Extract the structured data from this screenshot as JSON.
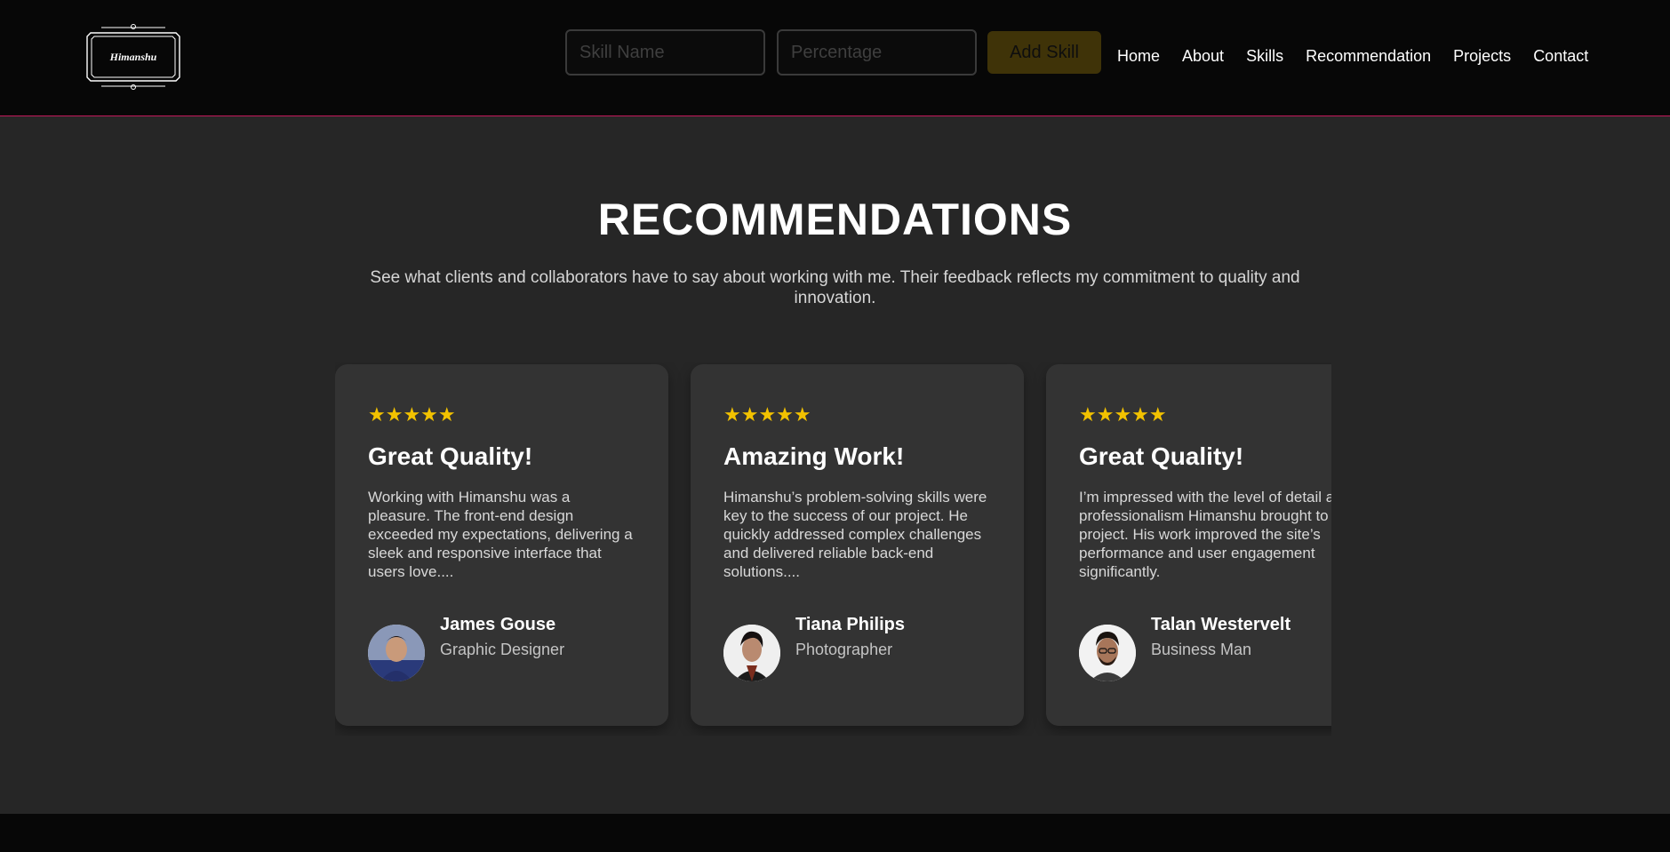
{
  "logo": {
    "text": "Himanshu"
  },
  "skill_form": {
    "name_placeholder": "Skill Name",
    "percentage_placeholder": "Percentage",
    "add_label": "Add Skill"
  },
  "nav": [
    {
      "label": "Home"
    },
    {
      "label": "About"
    },
    {
      "label": "Skills"
    },
    {
      "label": "Recommendation"
    },
    {
      "label": "Projects"
    },
    {
      "label": "Contact"
    }
  ],
  "section": {
    "title": "RECOMMENDATIONS",
    "subtitle": "See what clients and collaborators have to say about working with me. Their feedback reflects my commitment to quality and innovation."
  },
  "recommendations": [
    {
      "stars": "★★★★★",
      "rating": 5,
      "heading": "Great Quality!",
      "text": "Working with Himanshu was a pleasure. The front-end design exceeded my expectations, delivering a sleek and responsive interface that users love....",
      "name": "James Gouse",
      "role": "Graphic Designer"
    },
    {
      "stars": "★★★★★",
      "rating": 5,
      "heading": "Amazing Work!",
      "text": "Himanshu’s problem-solving skills were key to the success of our project. He quickly addressed complex challenges and delivered reliable back-end solutions....",
      "name": "Tiana Philips",
      "role": "Photographer"
    },
    {
      "stars": "★★★★★",
      "rating": 5,
      "heading": "Great Quality!",
      "text": "I’m impressed with the level of detail and professionalism Himanshu brought to our project. His work improved the site’s performance and user engagement significantly.",
      "name": "Talan Westervelt",
      "role": "Business Man"
    }
  ],
  "colors": {
    "header_bg": "#070707",
    "header_border": "#c2185b",
    "page_bg": "#262626",
    "card_bg": "#333333",
    "star": "#f2c200",
    "add_button_bg": "#3f3308"
  }
}
